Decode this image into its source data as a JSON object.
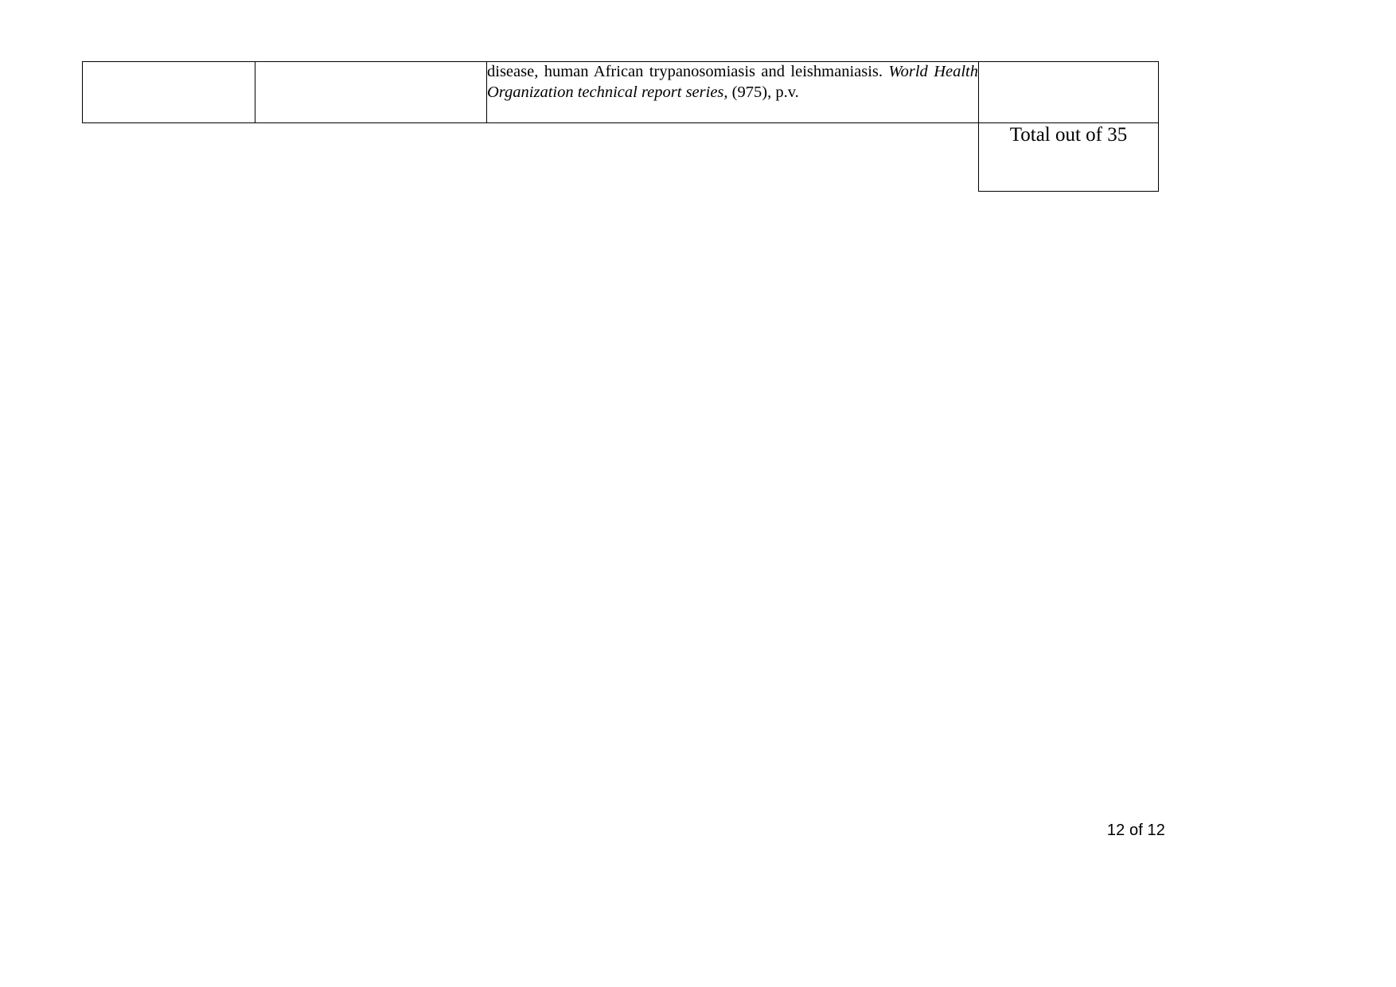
{
  "document": {
    "page_label": "12 of 12"
  },
  "table": {
    "columns": [
      {
        "name": "column-one",
        "value": ""
      },
      {
        "name": "column-two",
        "value": ""
      },
      {
        "name": "column-three",
        "value": "reference"
      },
      {
        "name": "column-four",
        "value": ""
      }
    ],
    "rows": [
      {
        "cell_one": "",
        "cell_two": "",
        "reference": {
          "line_one_plain": "disease, human African trypanosomiasis and leishmaniasis. ",
          "italic_title": "World Health Organization technical report series,",
          "trailing_plain": " (975), p.v.",
          "full_text": "disease, human African trypanosomiasis and leishmaniasis. World Health Organization technical report series, (975), p.v."
        },
        "cell_four": ""
      },
      {
        "spanned_cells": "",
        "total_label": "Total out of 35"
      }
    ]
  }
}
